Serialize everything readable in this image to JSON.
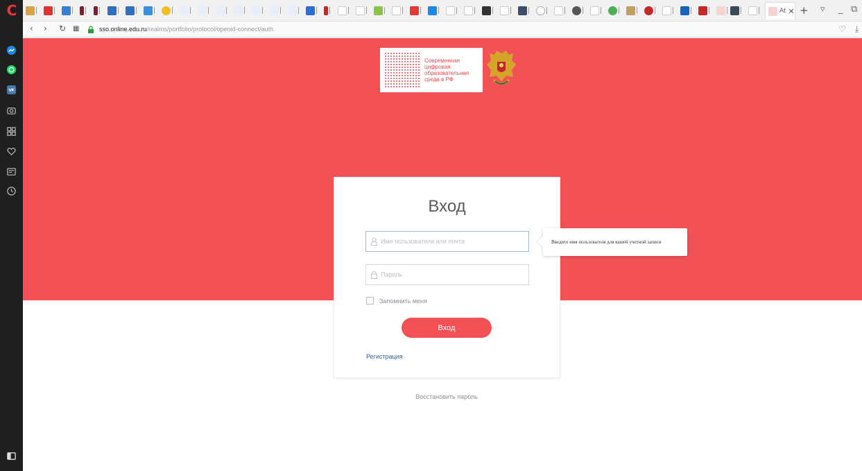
{
  "browser": {
    "url_host": "sso.online.edu.ru",
    "url_path": "/realms/portfolio/protocol/openid-connect/auth",
    "active_tab_label": "At",
    "new_tab_symbol": "+",
    "close_symbol": "✕"
  },
  "sidebar": {
    "icons": [
      "messenger-icon",
      "whatsapp-icon",
      "vk-icon",
      "camera-icon",
      "apps-grid-icon",
      "heart-icon",
      "news-icon",
      "history-icon",
      "panel-toggle-icon"
    ]
  },
  "brand": {
    "lines": [
      "Современная",
      "цифровая",
      "образовательная",
      "среда в РФ"
    ]
  },
  "login": {
    "title": "Вход",
    "username_placeholder": "Имя пользователя или почта",
    "password_placeholder": "Пароль",
    "remember_label": "Запомнить меня",
    "submit_label": "Вход",
    "register_link": "Регистрация",
    "tooltip": "Введите имя пользователя для вашей учетной записи",
    "forgot_link": "Восстановить пароль"
  },
  "colors": {
    "accent": "#f25256",
    "link": "#2d5ea8",
    "rail": "#1f1f1f"
  }
}
